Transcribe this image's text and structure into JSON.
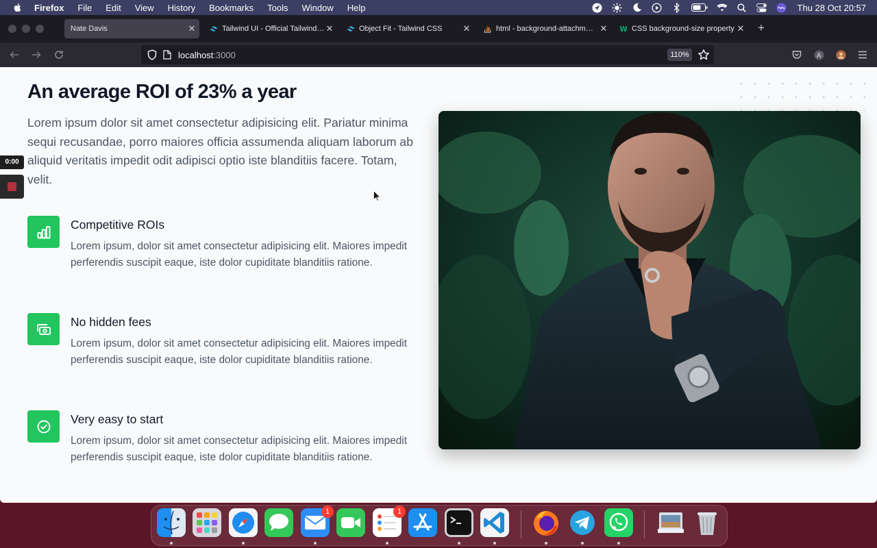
{
  "menubar": {
    "app_name": "Firefox",
    "menus": [
      "File",
      "Edit",
      "View",
      "History",
      "Bookmarks",
      "Tools",
      "Window",
      "Help"
    ],
    "clock": "Thu 28 Oct  20:57"
  },
  "tabs": [
    {
      "label": "Nate Davis",
      "active": true,
      "icon": "none"
    },
    {
      "label": "Tailwind UI - Official Tailwind CSS",
      "active": false,
      "icon": "tailwind-icon"
    },
    {
      "label": "Object Fit - Tailwind CSS",
      "active": false,
      "icon": "tailwind-icon"
    },
    {
      "label": "html - background-attachment: fix",
      "active": false,
      "icon": "stackoverflow-icon"
    },
    {
      "label": "CSS background-size property",
      "active": false,
      "icon": "w3schools-icon"
    }
  ],
  "navbar": {
    "url_host": "localhost",
    "url_port": ":3000",
    "zoom": "110%"
  },
  "page": {
    "heading": "An average ROI of 23% a year",
    "intro": "Lorem ipsum dolor sit amet consectetur adipisicing elit. Pariatur minima sequi recusandae, porro maiores officia assumenda aliquam laborum ab aliquid veritatis impedit odit adipisci optio iste blanditiis facere. Totam, velit.",
    "features": [
      {
        "title": "Competitive ROIs",
        "description": "Lorem ipsum, dolor sit amet consectetur adipisicing elit. Maiores impedit perferendis suscipit eaque, iste dolor cupiditate blanditiis ratione.",
        "icon": "bar-chart-icon"
      },
      {
        "title": "No hidden fees",
        "description": "Lorem ipsum, dolor sit amet consectetur adipisicing elit. Maiores impedit perferendis suscipit eaque, iste dolor cupiditate blanditiis ratione.",
        "icon": "cash-icon"
      },
      {
        "title": "Very easy to start",
        "description": "Lorem ipsum, dolor sit amet consectetur adipisicing elit. Maiores impedit perferendis suscipit eaque, iste dolor cupiditate blanditiis ratione.",
        "icon": "check-circle-icon"
      }
    ],
    "accent_color": "#22c55e"
  },
  "recording": {
    "time": "0:00"
  },
  "dock": {
    "items": [
      "finder",
      "launchpad",
      "safari",
      "messages",
      "mail",
      "facetime",
      "reminders",
      "app-store",
      "terminal",
      "vscode",
      "firefox",
      "telegram",
      "whatsapp",
      "downloads",
      "trash"
    ],
    "mail_badge": "1",
    "reminders_badge": "1"
  }
}
